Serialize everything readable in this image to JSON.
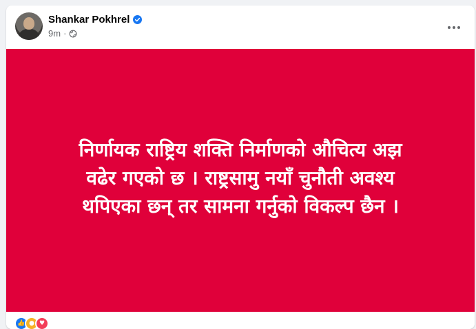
{
  "post": {
    "author": "Shankar Pokhrel",
    "time": "9m",
    "separator": "·",
    "text_lines": [
      "निर्णायक राष्ट्रिय शक्ति निर्माणको औचित्य अझ",
      "वढेर गएको छ । राष्ट्रसामु नयाँ चुनौती अवश्य",
      "थपिएका छन् तर सामना गर्नुको विकल्प छैन ।"
    ],
    "background_color": "#e0003a"
  },
  "icons": {
    "verified": "verified-badge-icon",
    "privacy": "globe-icon",
    "more": "more-options-icon"
  }
}
